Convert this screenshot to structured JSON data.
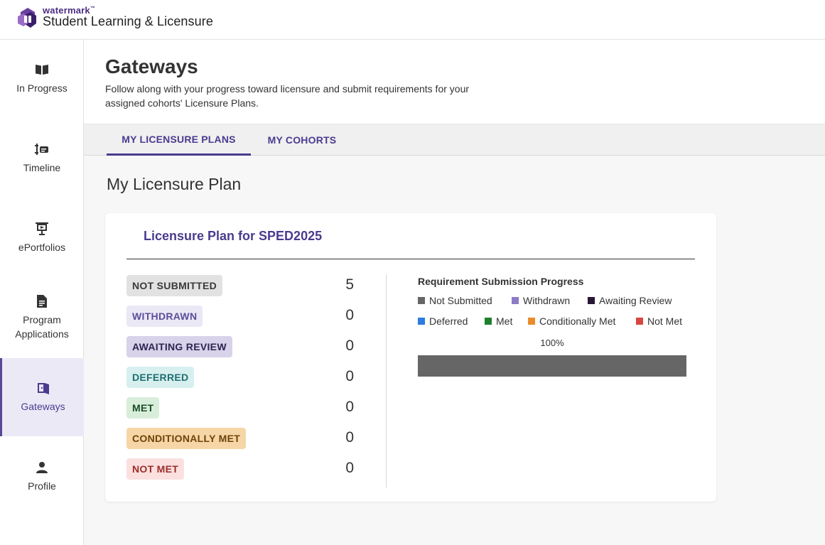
{
  "brand": {
    "small": "watermark",
    "tm": "™",
    "main": "Student Learning & Licensure"
  },
  "sidebar": {
    "items": [
      {
        "label": "In Progress",
        "icon": "book-open-icon"
      },
      {
        "label": "Timeline",
        "icon": "timeline-icon"
      },
      {
        "label": "ePortfolios",
        "icon": "presentation-icon"
      },
      {
        "label": "Program Applications",
        "icon": "document-icon"
      },
      {
        "label": "Gateways",
        "icon": "gateway-icon",
        "active": true
      },
      {
        "label": "Profile",
        "icon": "person-icon"
      }
    ]
  },
  "header": {
    "title": "Gateways",
    "description": "Follow along with your progress toward licensure and submit requirements for your assigned cohorts' Licensure Plans."
  },
  "tabs": [
    {
      "label": "MY LICENSURE PLANS",
      "active": true
    },
    {
      "label": "MY COHORTS",
      "active": false
    }
  ],
  "section_title": "My Licensure Plan",
  "card": {
    "title": "Licensure Plan for SPED2025",
    "statuses": [
      {
        "label": "NOT SUBMITTED",
        "count": "5",
        "bg": "#e2e2e2",
        "fg": "#3a3a3a"
      },
      {
        "label": "WITHDRAWN",
        "count": "0",
        "bg": "#ebe8f5",
        "fg": "#5b4e9a"
      },
      {
        "label": "AWAITING REVIEW",
        "count": "0",
        "bg": "#d8d2ea",
        "fg": "#2f2551"
      },
      {
        "label": "DEFERRED",
        "count": "0",
        "bg": "#d7f0ef",
        "fg": "#1f6d72"
      },
      {
        "label": "MET",
        "count": "0",
        "bg": "#d8eedb",
        "fg": "#1a4d23"
      },
      {
        "label": "CONDITIONALLY MET",
        "count": "0",
        "bg": "#f6d6a7",
        "fg": "#6f4207"
      },
      {
        "label": "NOT MET",
        "count": "0",
        "bg": "#fbe0df",
        "fg": "#9b2e2a"
      }
    ],
    "progress": {
      "title": "Requirement Submission Progress",
      "legend": [
        {
          "label": "Not Submitted",
          "color": "#666666"
        },
        {
          "label": "Withdrawn",
          "color": "#8c7cc7"
        },
        {
          "label": "Awaiting Review",
          "color": "#2a1736"
        },
        {
          "label": "Deferred",
          "color": "#2b7de0"
        },
        {
          "label": "Met",
          "color": "#1f7f2c"
        },
        {
          "label": "Conditionally Met",
          "color": "#e98b2a"
        },
        {
          "label": "Not Met",
          "color": "#d9463f"
        }
      ],
      "percent_label": "100%",
      "segments": [
        {
          "name": "Not Submitted",
          "fraction": 1.0,
          "color": "#666666"
        }
      ]
    }
  }
}
